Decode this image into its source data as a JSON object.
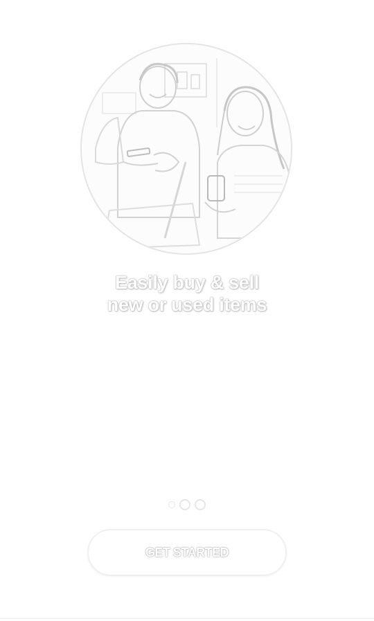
{
  "onboarding": {
    "hero_image": {
      "description_icon": "people-using-phones-illustration"
    },
    "headline": {
      "line1": "Easily buy & sell",
      "line2": "new or used items"
    },
    "pager": {
      "total": 3,
      "active_index": 0
    },
    "cta": {
      "label": "GET STARTED"
    }
  },
  "colors": {
    "background": "#ffffff",
    "outline": "#e4e4e4",
    "text_shadow": "#9a9a9a"
  }
}
